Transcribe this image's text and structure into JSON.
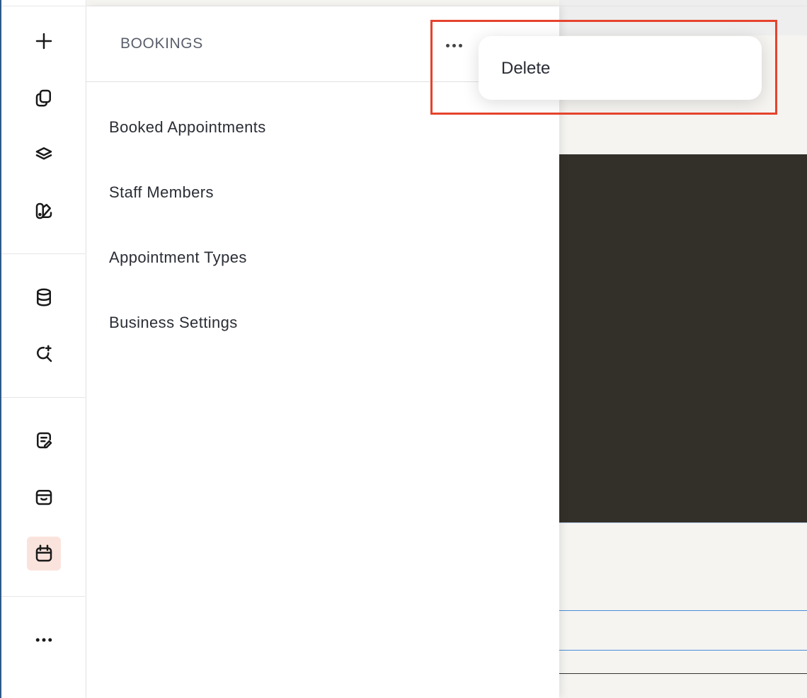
{
  "panel": {
    "title": "BOOKINGS",
    "nav_items": [
      {
        "label": "Booked Appointments"
      },
      {
        "label": "Staff Members"
      },
      {
        "label": "Appointment Types"
      },
      {
        "label": "Business Settings"
      }
    ]
  },
  "menu": {
    "items": [
      {
        "label": "Delete"
      }
    ]
  },
  "rail": {
    "icons": [
      "add-icon",
      "pages-icon",
      "layers-icon",
      "design-icon",
      "database-icon",
      "ai-search-icon",
      "blog-icon",
      "store-icon",
      "bookings-icon",
      "more-icon"
    ],
    "active": "bookings-icon",
    "active_color": "#fbe3dd"
  },
  "highlight_color": "#e5432d"
}
